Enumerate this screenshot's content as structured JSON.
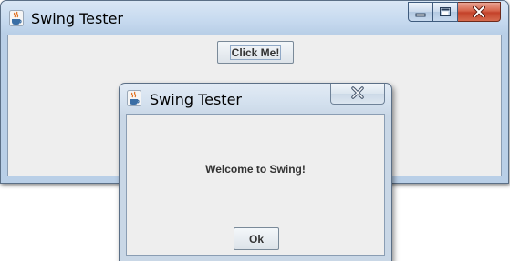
{
  "main_window": {
    "title": "Swing Tester",
    "app_icon": "java-coffee-cup-icon",
    "caption_buttons": [
      "minimize-icon",
      "maximize-icon",
      "close-icon"
    ],
    "click_button_label": "Click Me!"
  },
  "dialog": {
    "title": "Swing Tester",
    "app_icon": "java-coffee-cup-icon",
    "close_icon": "close-icon",
    "message": "Welcome to Swing!",
    "ok_button_label": "Ok"
  },
  "colors": {
    "title_bar_active": "#b9cfe7",
    "title_bar_inactive": "#c9d7e6",
    "client_background": "#eeeeee",
    "close_button_red": "#c4422a",
    "button_text": "#333333"
  }
}
